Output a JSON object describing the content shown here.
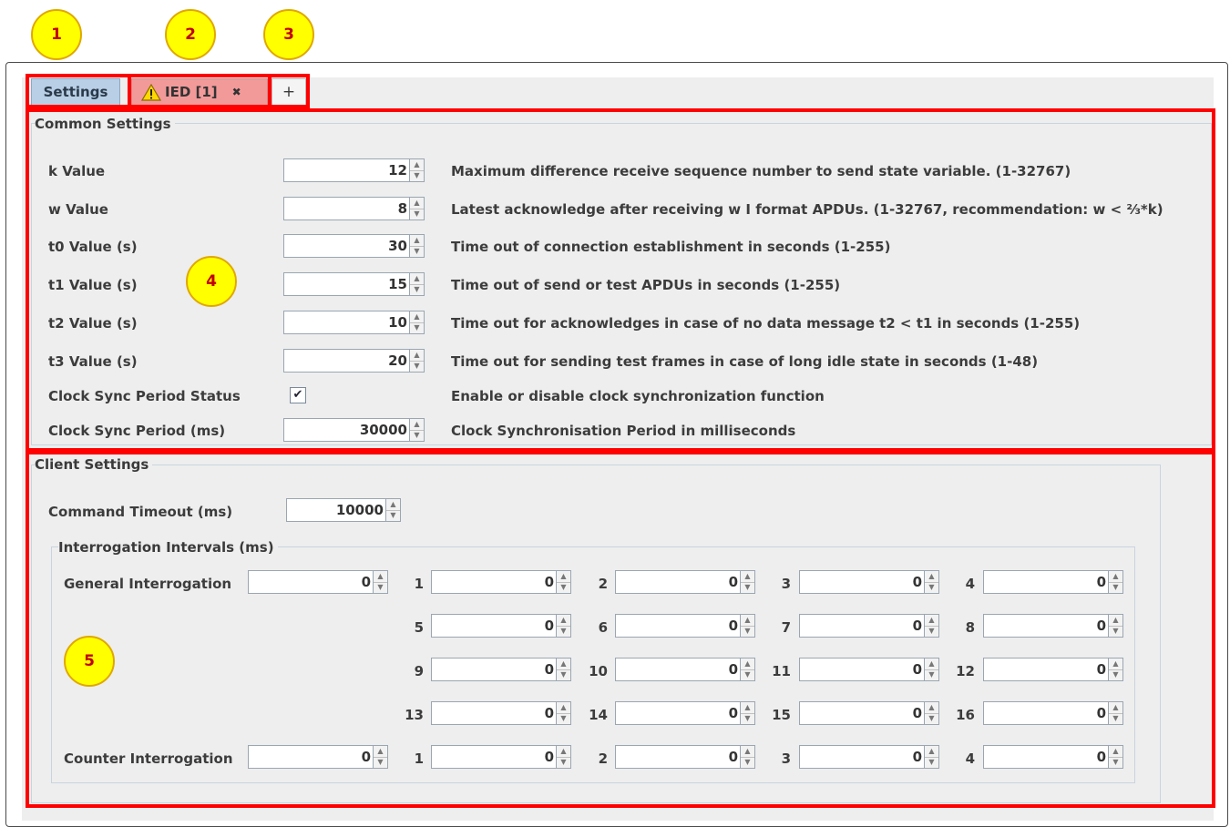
{
  "callouts": [
    "1",
    "2",
    "3",
    "4",
    "5"
  ],
  "tabs": {
    "settings": "Settings",
    "ied": "IED [1]",
    "ied_close": "✖",
    "add": "+"
  },
  "common": {
    "title": "Common Settings",
    "rows": [
      {
        "label": "k Value",
        "value": "12",
        "desc": "Maximum difference receive sequence number to send state variable. (1-32767)"
      },
      {
        "label": "w Value",
        "value": "8",
        "desc": "Latest acknowledge after receiving w I format APDUs. (1-32767, recommendation: w < ⅔*k)"
      },
      {
        "label": "t0 Value (s)",
        "value": "30",
        "desc": "Time out of connection establishment in seconds (1-255)"
      },
      {
        "label": "t1 Value (s)",
        "value": "15",
        "desc": "Time out of send or test APDUs in seconds (1-255)"
      },
      {
        "label": "t2 Value (s)",
        "value": "10",
        "desc": "Time out for acknowledges in case of no data message t2 < t1 in seconds (1-255)"
      },
      {
        "label": "t3 Value (s)",
        "value": "20",
        "desc": "Time out for sending test frames in case of long idle state in seconds (1-48)"
      }
    ],
    "clock_status": {
      "label": "Clock Sync Period Status",
      "checked": true,
      "desc": "Enable or disable clock synchronization function"
    },
    "clock_period": {
      "label": "Clock Sync Period (ms)",
      "value": "30000",
      "desc": "Clock Synchronisation Period in milliseconds"
    }
  },
  "client": {
    "title": "Client Settings",
    "command_timeout": {
      "label": "Command Timeout (ms)",
      "value": "10000"
    },
    "intervals": {
      "title": "Interrogation Intervals (ms)",
      "general": {
        "label": "General Interrogation",
        "value": "0"
      },
      "counter": {
        "label": "Counter Interrogation",
        "value": "0"
      },
      "groups": [
        {
          "n": "1",
          "value": "0"
        },
        {
          "n": "2",
          "value": "0"
        },
        {
          "n": "3",
          "value": "0"
        },
        {
          "n": "4",
          "value": "0"
        },
        {
          "n": "5",
          "value": "0"
        },
        {
          "n": "6",
          "value": "0"
        },
        {
          "n": "7",
          "value": "0"
        },
        {
          "n": "8",
          "value": "0"
        },
        {
          "n": "9",
          "value": "0"
        },
        {
          "n": "10",
          "value": "0"
        },
        {
          "n": "11",
          "value": "0"
        },
        {
          "n": "12",
          "value": "0"
        },
        {
          "n": "13",
          "value": "0"
        },
        {
          "n": "14",
          "value": "0"
        },
        {
          "n": "15",
          "value": "0"
        },
        {
          "n": "16",
          "value": "0"
        }
      ],
      "counter_groups": [
        {
          "n": "1",
          "value": "0"
        },
        {
          "n": "2",
          "value": "0"
        },
        {
          "n": "3",
          "value": "0"
        },
        {
          "n": "4",
          "value": "0"
        }
      ]
    }
  },
  "colors": {
    "highlight": "#ff0000",
    "callout": "#ffff00",
    "tab_settings": "#b8cfe5",
    "tab_ied": "#f29a9a"
  }
}
